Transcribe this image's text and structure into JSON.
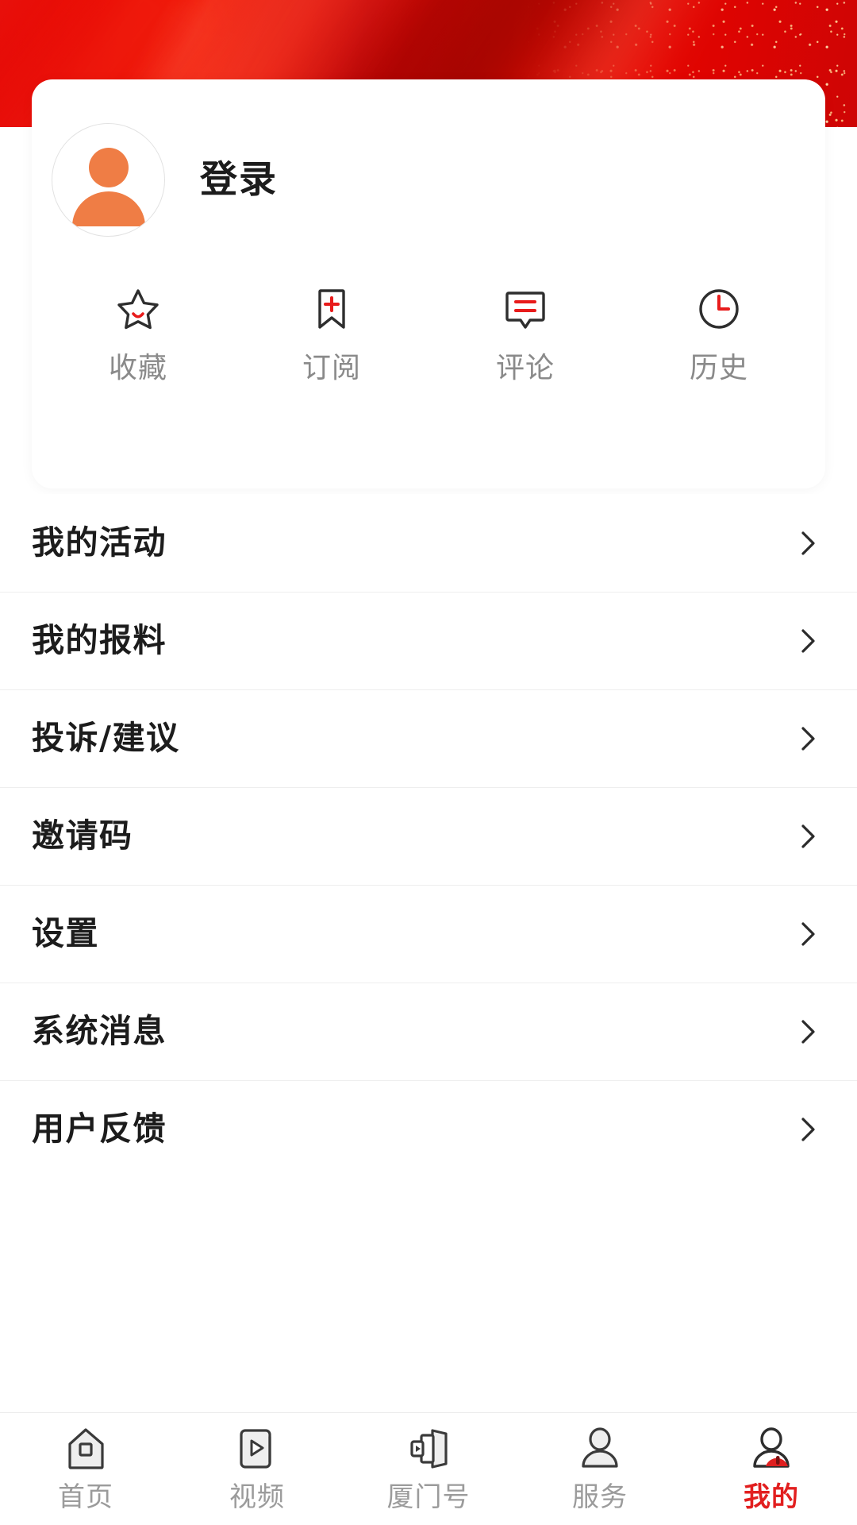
{
  "theme": {
    "brand_red": "#e30000",
    "accent_red": "#e21f1f",
    "avatar_orange": "#ef7d45",
    "icon_dark": "#2e2e2e",
    "muted_text": "#8a8a8a",
    "primary_text": "#1c1c1c"
  },
  "profile": {
    "login_label": "登录",
    "avatar_icon": "user-avatar-placeholder-icon",
    "quick_actions": [
      {
        "label": "收藏",
        "icon": "star-smile-icon"
      },
      {
        "label": "订阅",
        "icon": "bookmark-plus-icon"
      },
      {
        "label": "评论",
        "icon": "comment-lines-icon"
      },
      {
        "label": "历史",
        "icon": "clock-history-icon"
      }
    ]
  },
  "menu": {
    "items": [
      {
        "label": "我的活动",
        "chevron": "chevron-right-icon"
      },
      {
        "label": "我的报料",
        "chevron": "chevron-right-icon"
      },
      {
        "label": "投诉/建议",
        "chevron": "chevron-right-icon"
      },
      {
        "label": "邀请码",
        "chevron": "chevron-right-icon"
      },
      {
        "label": "设置",
        "chevron": "chevron-right-icon"
      },
      {
        "label": "系统消息",
        "chevron": "chevron-right-icon"
      },
      {
        "label": "用户反馈",
        "chevron": "chevron-right-icon"
      }
    ]
  },
  "tabbar": {
    "items": [
      {
        "label": "首页",
        "icon": "home-icon",
        "active": false
      },
      {
        "label": "视频",
        "icon": "video-play-icon",
        "active": false
      },
      {
        "label": "厦门号",
        "icon": "channel-screens-icon",
        "active": false
      },
      {
        "label": "服务",
        "icon": "person-service-icon",
        "active": false
      },
      {
        "label": "我的",
        "icon": "person-mine-icon",
        "active": true
      }
    ]
  }
}
